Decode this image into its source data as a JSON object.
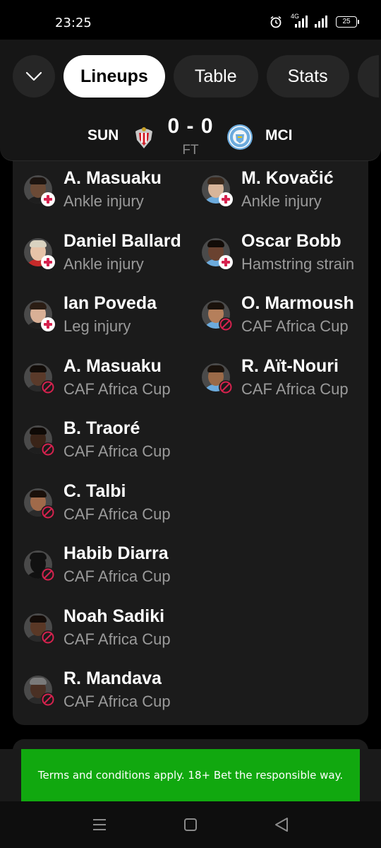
{
  "status_bar": {
    "time": "23:25",
    "network": "4G",
    "battery": "25"
  },
  "tabs": [
    {
      "label": "Lineups",
      "active": true
    },
    {
      "label": "Table",
      "active": false
    },
    {
      "label": "Stats",
      "active": false
    }
  ],
  "match": {
    "home_team": "SUN",
    "away_team": "MCI",
    "score": "0 - 0",
    "status": "FT"
  },
  "home_absences": [
    {
      "name": "A. Masuaku",
      "reason": "Ankle injury",
      "type": "injury"
    },
    {
      "name": "Daniel Ballard",
      "reason": "Ankle injury",
      "type": "injury"
    },
    {
      "name": "Ian Poveda",
      "reason": "Leg injury",
      "type": "injury"
    },
    {
      "name": "A. Masuaku",
      "reason": "CAF Africa Cup",
      "type": "absent"
    },
    {
      "name": "B. Traoré",
      "reason": "CAF Africa Cup",
      "type": "absent"
    },
    {
      "name": "C. Talbi",
      "reason": "CAF Africa Cup",
      "type": "absent"
    },
    {
      "name": "Habib Diarra",
      "reason": "CAF Africa Cup",
      "type": "absent"
    },
    {
      "name": "Noah Sadiki",
      "reason": "CAF Africa Cup",
      "type": "absent"
    },
    {
      "name": "R. Mandava",
      "reason": "CAF Africa Cup",
      "type": "absent"
    }
  ],
  "away_absences": [
    {
      "name": "M. Kovačić",
      "reason": "Ankle injury",
      "type": "injury"
    },
    {
      "name": "Oscar Bobb",
      "reason": "Hamstring strain",
      "type": "injury"
    },
    {
      "name": "O. Marmoush",
      "reason": "CAF Africa Cup",
      "type": "absent"
    },
    {
      "name": "R. Aït-Nouri",
      "reason": "CAF Africa Cup",
      "type": "absent"
    }
  ],
  "ad": {
    "text": "Terms and conditions apply. 18+ Bet the responsible way.",
    "color": "#11a80f"
  },
  "colors": {
    "background": "#000000",
    "panel": "#1b1b1b",
    "injury_accent": "#d6224e"
  }
}
